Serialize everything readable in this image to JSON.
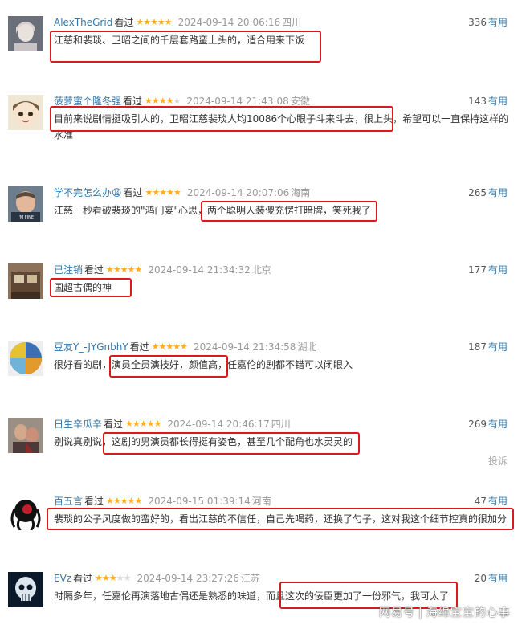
{
  "reviews": [
    {
      "username": "AlexTheGrid",
      "status": "看过",
      "rating": 5,
      "time": "2024-09-14 20:06:16",
      "location": "四川",
      "votes": "336",
      "vote_label": "有用",
      "text": "江慈和裴琰、卫昭之间的千层套路蛮上头的，适合用来下饭"
    },
    {
      "username": "菠萝蜜个隆冬强",
      "status": "看过",
      "rating": 4,
      "time": "2024-09-14 21:43:08",
      "location": "安徽",
      "votes": "143",
      "vote_label": "有用",
      "text": "目前来说剧情挺吸引人的，卫昭江慈裴琰人均10086个心眼子斗来斗去，很上头，希望可以一直保持这样的水准"
    },
    {
      "username": "学不完怎么办😩",
      "status": "看过",
      "rating": 5,
      "time": "2024-09-14 20:07:06",
      "location": "海南",
      "votes": "265",
      "vote_label": "有用",
      "text": "江慈一秒看破裴琰的\"鸿门宴\"心思，两个聪明人装傻充愣打暗牌，笑死我了"
    },
    {
      "username": "已注销",
      "status": "看过",
      "rating": 5,
      "time": "2024-09-14 21:34:32",
      "location": "北京",
      "votes": "177",
      "vote_label": "有用",
      "text": "国超古偶的神"
    },
    {
      "username": "豆友Y_-JYGnbhY",
      "status": "看过",
      "rating": 5,
      "time": "2024-09-14 21:34:58",
      "location": "湖北",
      "votes": "187",
      "vote_label": "有用",
      "text": "很好看的剧，演员全员演技好，颜值高，任嘉伦的剧都不错可以闭眼入"
    },
    {
      "username": "日生辛瓜辛",
      "status": "看过",
      "rating": 5,
      "time": "2024-09-14 20:46:17",
      "location": "四川",
      "votes": "269",
      "vote_label": "有用",
      "text": "别说真别说，这剧的男演员都长得挺有姿色，甚至几个配角也水灵灵的"
    },
    {
      "username": "百五言",
      "status": "看过",
      "rating": 5,
      "time": "2024-09-15 01:39:14",
      "location": "河南",
      "votes": "47",
      "vote_label": "有用",
      "text": "裴琰的公子风度做的蛮好的，看出江慈的不信任，自己先喝药，还换了勺子，这对我这个细节控真的很加分"
    },
    {
      "username": "EVz",
      "status": "看过",
      "rating": 3,
      "time": "2024-09-14 23:27:26",
      "location": "江苏",
      "votes": "20",
      "vote_label": "有用",
      "text": "时隔多年，任嘉伦再演落地古偶还是熟悉的味道，而且这次的佞臣更加了一份邪气，我可太了"
    }
  ],
  "report_label": "投诉",
  "watermark": {
    "brand": "网易号",
    "sep": "|",
    "account": "海绵宝宝的心事"
  },
  "colors": {
    "username": "#3377aa",
    "star": "#ffac2d",
    "highlight": "#d9191c"
  }
}
